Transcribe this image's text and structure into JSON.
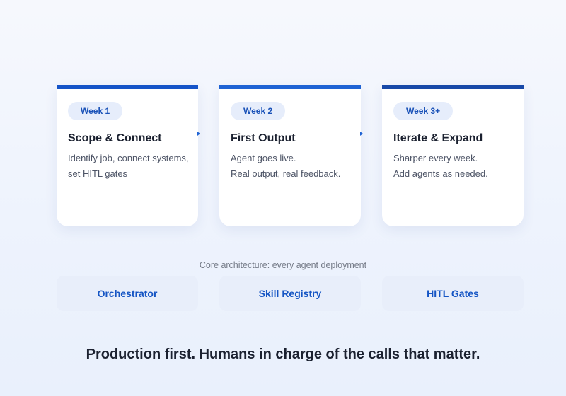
{
  "colors": {
    "accent": "#1554c8",
    "badge_bg": "#e6edfb",
    "pill_bg": "#e8eefa",
    "text_dark": "#1b2130",
    "text_muted": "#4d5466"
  },
  "phases": [
    {
      "badge": "Week 1",
      "title": "Scope & Connect",
      "lines": [
        "Identify job, connect systems,",
        "set HITL gates"
      ]
    },
    {
      "badge": "Week 2",
      "title": "First Output",
      "lines": [
        "Agent goes live.",
        "Real output, real feedback."
      ]
    },
    {
      "badge": "Week 3+",
      "title": "Iterate & Expand",
      "lines": [
        "Sharper every week.",
        "Add agents as needed."
      ]
    }
  ],
  "architecture": {
    "caption": "Core architecture: every agent deployment",
    "components": [
      "Orchestrator",
      "Skill Registry",
      "HITL Gates"
    ]
  },
  "tagline": "Production first. Humans in charge of the calls that matter."
}
